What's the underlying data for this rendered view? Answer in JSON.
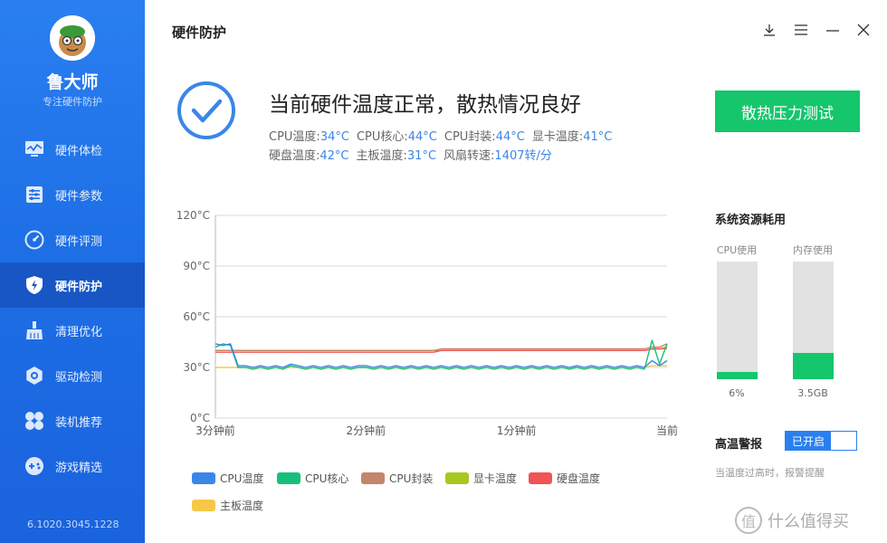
{
  "app": {
    "name": "鲁大师",
    "subtitle": "专注硬件防护",
    "version": "6.1020.3045.1228"
  },
  "sidebar": {
    "items": [
      {
        "label": "硬件体检",
        "icon": "monitor-icon"
      },
      {
        "label": "硬件参数",
        "icon": "sliders-icon"
      },
      {
        "label": "硬件评测",
        "icon": "gauge-icon"
      },
      {
        "label": "硬件防护",
        "icon": "shield-lightning-icon",
        "active": true
      },
      {
        "label": "清理优化",
        "icon": "broom-icon"
      },
      {
        "label": "驱动检测",
        "icon": "gear-icon"
      },
      {
        "label": "装机推荐",
        "icon": "fan-icon"
      },
      {
        "label": "游戏精选",
        "icon": "gamepad-icon"
      }
    ]
  },
  "header": {
    "title": "硬件防护"
  },
  "window_controls": [
    "download-icon",
    "menu-icon",
    "minimize-icon",
    "close-icon"
  ],
  "status": {
    "headline": "当前硬件温度正常，散热情况良好",
    "stats": [
      {
        "label": "CPU温度:",
        "value": "34°C"
      },
      {
        "label": "CPU核心:",
        "value": "44°C"
      },
      {
        "label": "CPU封装:",
        "value": "44°C"
      },
      {
        "label": "显卡温度:",
        "value": "41°C"
      },
      {
        "label": "硬盘温度:",
        "value": "42°C"
      },
      {
        "label": "主板温度:",
        "value": "31°C"
      },
      {
        "label": "风扇转速:",
        "value": "1407转/分"
      }
    ],
    "stress_button": "散热压力测试"
  },
  "colors": {
    "accent": "#2a7ff0",
    "green": "#15c66d",
    "cpu_temp": "#3a86e8",
    "cpu_core": "#17c07a",
    "cpu_package": "#c4866b",
    "gpu_temp": "#a8c81f",
    "disk_temp": "#f05454",
    "board_temp": "#f5c84a"
  },
  "chart_data": {
    "type": "line",
    "y_ticks": [
      "120°C",
      "90°C",
      "60°C",
      "30°C",
      "0°C"
    ],
    "x_ticks": [
      "3分钟前",
      "2分钟前",
      "1分钟前",
      "当前"
    ],
    "ylim": [
      0,
      120
    ],
    "x": [
      0,
      1,
      2,
      3,
      4,
      5,
      6,
      7,
      8,
      9,
      10,
      11,
      12,
      13,
      14,
      15,
      16,
      17,
      18,
      19,
      20,
      21,
      22,
      23,
      24,
      25,
      26,
      27,
      28,
      29,
      30,
      31,
      32,
      33,
      34,
      35,
      36,
      37,
      38,
      39,
      40,
      41,
      42,
      43,
      44,
      45,
      46,
      47,
      48,
      49,
      50,
      51,
      52,
      53,
      54,
      55,
      56,
      57,
      58,
      59,
      60
    ],
    "series": [
      {
        "name": "CPU温度",
        "color": "#3a86e8",
        "values": [
          44,
          43,
          44,
          31,
          31,
          30,
          31,
          30,
          31,
          30,
          32,
          31,
          30,
          31,
          30,
          31,
          30,
          31,
          30,
          31,
          31,
          30,
          31,
          30,
          31,
          30,
          31,
          30,
          31,
          30,
          31,
          30,
          31,
          30,
          31,
          30,
          31,
          30,
          31,
          30,
          31,
          30,
          31,
          30,
          31,
          30,
          31,
          30,
          31,
          30,
          31,
          30,
          31,
          30,
          31,
          30,
          31,
          30,
          34,
          31,
          34
        ]
      },
      {
        "name": "CPU核心",
        "color": "#17c07a",
        "values": [
          42,
          44,
          43,
          30,
          30,
          29,
          30,
          29,
          30,
          29,
          31,
          30,
          29,
          30,
          29,
          30,
          29,
          30,
          29,
          30,
          30,
          29,
          30,
          29,
          30,
          29,
          30,
          29,
          30,
          29,
          30,
          29,
          30,
          29,
          30,
          29,
          30,
          29,
          30,
          29,
          30,
          29,
          30,
          29,
          30,
          29,
          30,
          29,
          30,
          29,
          30,
          29,
          30,
          29,
          30,
          29,
          30,
          29,
          46,
          32,
          44
        ]
      },
      {
        "name": "CPU封装",
        "color": "#c4866b",
        "values": [
          40,
          40,
          40,
          40,
          40,
          40,
          40,
          40,
          40,
          40,
          40,
          40,
          40,
          40,
          40,
          40,
          40,
          40,
          40,
          40,
          40,
          40,
          40,
          40,
          40,
          40,
          40,
          40,
          40,
          40,
          41,
          41,
          41,
          41,
          41,
          41,
          41,
          41,
          41,
          41,
          41,
          41,
          41,
          41,
          41,
          41,
          41,
          41,
          41,
          41,
          41,
          41,
          41,
          41,
          41,
          41,
          41,
          41,
          42,
          42,
          44
        ]
      },
      {
        "name": "显卡温度",
        "color": "#a8c81f",
        "values": [
          40,
          40,
          40,
          40,
          40,
          40,
          40,
          40,
          40,
          40,
          40,
          40,
          40,
          40,
          40,
          40,
          40,
          40,
          40,
          40,
          40,
          40,
          40,
          40,
          40,
          40,
          40,
          40,
          40,
          40,
          40,
          40,
          40,
          40,
          40,
          40,
          40,
          40,
          40,
          40,
          40,
          40,
          40,
          40,
          40,
          40,
          40,
          40,
          40,
          40,
          40,
          40,
          40,
          40,
          40,
          40,
          40,
          40,
          41,
          41,
          41
        ]
      },
      {
        "name": "硬盘温度",
        "color": "#f05454",
        "values": [
          39,
          39,
          39,
          39,
          39,
          39,
          39,
          39,
          39,
          39,
          39,
          39,
          39,
          39,
          39,
          39,
          39,
          39,
          39,
          39,
          39,
          39,
          39,
          39,
          39,
          39,
          39,
          39,
          39,
          39,
          40,
          40,
          40,
          40,
          40,
          40,
          40,
          40,
          40,
          40,
          40,
          40,
          40,
          40,
          40,
          40,
          40,
          40,
          40,
          40,
          40,
          40,
          40,
          40,
          40,
          40,
          40,
          40,
          41,
          41,
          42
        ]
      },
      {
        "name": "主板温度",
        "color": "#f5c84a",
        "values": [
          30,
          30,
          30,
          30,
          30,
          30,
          30,
          30,
          30,
          30,
          30,
          30,
          30,
          30,
          30,
          30,
          30,
          30,
          30,
          30,
          30,
          30,
          30,
          30,
          30,
          30,
          30,
          30,
          30,
          30,
          30,
          30,
          30,
          30,
          30,
          30,
          30,
          30,
          30,
          30,
          30,
          30,
          30,
          30,
          30,
          30,
          30,
          30,
          30,
          30,
          30,
          30,
          30,
          30,
          30,
          30,
          30,
          30,
          31,
          31,
          31
        ]
      }
    ]
  },
  "resources": {
    "title": "系统资源耗用",
    "cpu": {
      "label": "CPU使用",
      "value": "6%",
      "fraction": 0.06
    },
    "mem": {
      "label": "内存使用",
      "value": "3.5GB",
      "fraction": 0.22
    }
  },
  "alarm": {
    "label": "高温警报",
    "toggle_text": "已开启",
    "description": "当温度过高时，报警提醒"
  },
  "watermark": "值 | 什么值得买"
}
